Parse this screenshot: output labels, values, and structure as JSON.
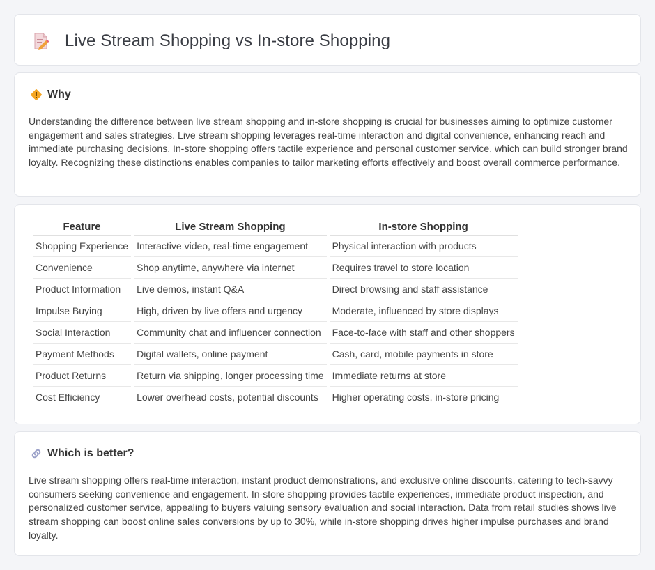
{
  "header": {
    "title": "Live Stream Shopping vs In-store Shopping",
    "icon": "document-pencil-icon"
  },
  "why": {
    "title": "Why",
    "icon": "diamond-sign-icon",
    "text": "Understanding the difference between live stream shopping and in-store shopping is crucial for businesses aiming to optimize customer engagement and sales strategies. Live stream shopping leverages real-time interaction and digital convenience, enhancing reach and immediate purchasing decisions. In-store shopping offers tactile experience and personal customer service, which can build stronger brand loyalty. Recognizing these distinctions enables companies to tailor marketing efforts effectively and boost overall commerce performance."
  },
  "table": {
    "headers": [
      "Feature",
      "Live Stream Shopping",
      "In-store Shopping"
    ],
    "rows": [
      [
        "Shopping Experience",
        "Interactive video, real-time engagement",
        "Physical interaction with products"
      ],
      [
        "Convenience",
        "Shop anytime, anywhere via internet",
        "Requires travel to store location"
      ],
      [
        "Product Information",
        "Live demos, instant Q&A",
        "Direct browsing and staff assistance"
      ],
      [
        "Impulse Buying",
        "High, driven by live offers and urgency",
        "Moderate, influenced by store displays"
      ],
      [
        "Social Interaction",
        "Community chat and influencer connection",
        "Face-to-face with staff and other shoppers"
      ],
      [
        "Payment Methods",
        "Digital wallets, online payment",
        "Cash, card, mobile payments in store"
      ],
      [
        "Product Returns",
        "Return via shipping, longer processing time",
        "Immediate returns at store"
      ],
      [
        "Cost Efficiency",
        "Lower overhead costs, potential discounts",
        "Higher operating costs, in-store pricing"
      ]
    ]
  },
  "better": {
    "title": "Which is better?",
    "icon": "link-icon",
    "text": "Live stream shopping offers real-time interaction, instant product demonstrations, and exclusive online discounts, catering to tech-savvy consumers seeking convenience and engagement. In-store shopping provides tactile experiences, immediate product inspection, and personalized customer service, appealing to buyers valuing sensory evaluation and social interaction. Data from retail studies shows live stream shopping can boost online sales conversions by up to 30%, while in-store shopping drives higher impulse purchases and brand loyalty."
  },
  "colors": {
    "accent_orange": "#f5a623",
    "icon_pink": "#e8607a",
    "link_purple": "#9aa0c8"
  }
}
